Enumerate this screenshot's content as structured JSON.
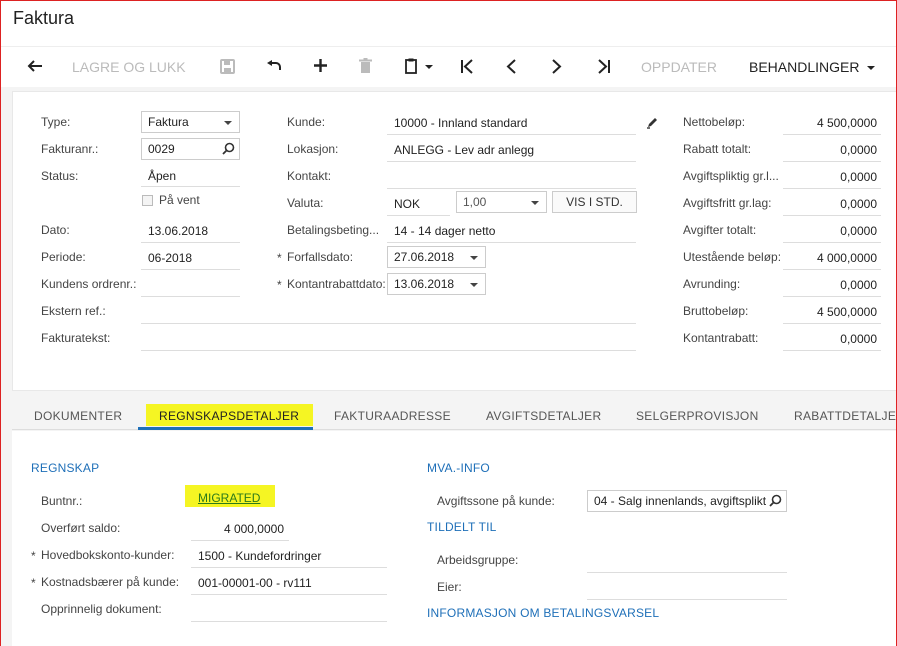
{
  "window": {
    "title": "Faktura"
  },
  "toolbar": {
    "save_close": "LAGRE OG LUKK",
    "update": "OPPDATER",
    "actions": "BEHANDLINGER"
  },
  "form": {
    "type_label": "Type:",
    "type_value": "Faktura",
    "invoice_no_label": "Fakturanr.:",
    "invoice_no_value": "0029",
    "status_label": "Status:",
    "status_value": "Åpen",
    "on_hold_label": "På vent",
    "date_label": "Dato:",
    "date_value": "13.06.2018",
    "period_label": "Periode:",
    "period_value": "06-2018",
    "customer_order_label": "Kundens ordrenr.:",
    "external_ref_label": "Ekstern ref.:",
    "invoice_text_label": "Fakturatekst:",
    "customer_label": "Kunde:",
    "customer_value": "10000 - Innland standard",
    "location_label": "Lokasjon:",
    "location_value": "ANLEGG - Lev adr anlegg",
    "contact_label": "Kontakt:",
    "currency_label": "Valuta:",
    "currency_value": "NOK",
    "rate_value": "1,00",
    "view_base": "VIS I STD.",
    "terms_label": "Betalingsbeting...",
    "terms_value": "14 - 14 dager netto",
    "due_date_label": "Forfallsdato:",
    "due_date_value": "27.06.2018",
    "cash_discount_date_label": "Kontantrabattdato:",
    "cash_discount_date_value": "13.06.2018"
  },
  "totals": {
    "net_label": "Nettobeløp:",
    "net_value": "4 500,0000",
    "discount_label": "Rabatt totalt:",
    "discount_value": "0,0000",
    "taxable_label": "Avgiftspliktig gr.l...",
    "taxable_value": "0,0000",
    "exempt_label": "Avgiftsfritt gr.lag:",
    "exempt_value": "0,0000",
    "tax_total_label": "Avgifter totalt:",
    "tax_total_value": "0,0000",
    "outstanding_label": "Utestående beløp:",
    "outstanding_value": "4 000,0000",
    "rounding_label": "Avrunding:",
    "rounding_value": "0,0000",
    "gross_label": "Bruttobeløp:",
    "gross_value": "4 500,0000",
    "cash_discount_label": "Kontantrabatt:",
    "cash_discount_value": "0,0000"
  },
  "tabs": [
    "DOKUMENTER",
    "REGNSKAPSDETALJER",
    "FAKTURAADRESSE",
    "AVGIFTSDETALJER",
    "SELGERPROVISJON",
    "RABATTDETALJER"
  ],
  "accounting": {
    "section": "REGNSKAP",
    "batch_label": "Buntnr.:",
    "batch_value": "MIGRATED",
    "transferred_label": "Overført saldo:",
    "transferred_value": "4 000,0000",
    "ar_account_label": "Hovedbokskonto-kunder:",
    "ar_account_value": "1500 - Kundefordringer",
    "cost_center_label": "Kostnadsbærer på kunde:",
    "cost_center_value": "001-00001-00 - rv111",
    "orig_doc_label": "Opprinnelig dokument:"
  },
  "vat": {
    "section": "MVA.-INFO",
    "zone_label": "Avgiftssone på kunde:",
    "zone_value": "04 - Salg innenlands, avgiftsplikt",
    "assigned_section": "TILDELT TIL",
    "workgroup_label": "Arbeidsgruppe:",
    "owner_label": "Eier:",
    "dunning_section": "INFORMASJON OM BETALINGSVARSEL"
  }
}
